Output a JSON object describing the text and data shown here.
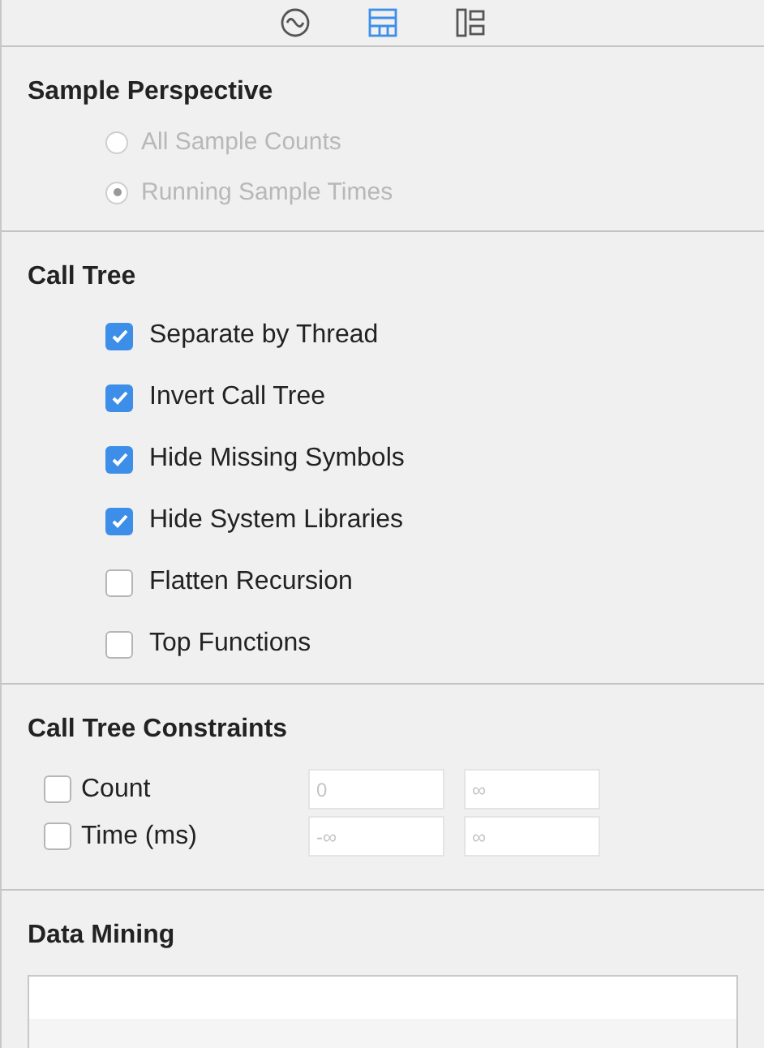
{
  "toolbar": [
    {
      "kind": "wave",
      "selected": false
    },
    {
      "kind": "table",
      "selected": true
    },
    {
      "kind": "tree",
      "selected": false
    }
  ],
  "sample_perspective": {
    "title": "Sample Perspective",
    "disabled": true,
    "options": [
      {
        "label": "All Sample Counts",
        "selected": false
      },
      {
        "label": "Running Sample Times",
        "selected": true
      }
    ]
  },
  "call_tree": {
    "title": "Call Tree",
    "options": [
      {
        "label": "Separate by Thread",
        "checked": true
      },
      {
        "label": "Invert Call Tree",
        "checked": true
      },
      {
        "label": "Hide Missing Symbols",
        "checked": true
      },
      {
        "label": "Hide System Libraries",
        "checked": true
      },
      {
        "label": "Flatten Recursion",
        "checked": false
      },
      {
        "label": "Top Functions",
        "checked": false
      }
    ]
  },
  "call_tree_constraints": {
    "title": "Call Tree Constraints",
    "rows": [
      {
        "label": "Count",
        "checked": false,
        "min_placeholder": "0",
        "max_placeholder": "∞"
      },
      {
        "label": "Time (ms)",
        "checked": false,
        "min_placeholder": "-∞",
        "max_placeholder": "∞"
      }
    ]
  },
  "data_mining": {
    "title": "Data Mining"
  }
}
